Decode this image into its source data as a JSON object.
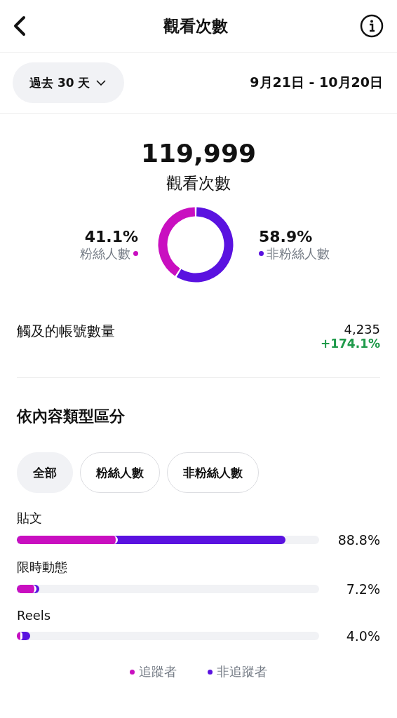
{
  "header": {
    "title": "觀看次數"
  },
  "filter": {
    "period": "過去 30 天",
    "date_range": "9月21日 - 10月20日"
  },
  "summary": {
    "total": "119,999",
    "label": "觀看次數",
    "stats": [
      {
        "value": "41.1%",
        "color": "#c90fc0"
      },
      {
        "value": "58.9%",
        "color": "#5a12e0"
      }
    ],
    "chart_data": {
      "type": "donut",
      "categories": [
        "粉絲人數",
        "非粉絲人數"
      ],
      "values": [
        41.1,
        58.9
      ]
    }
  },
  "reach": {
    "label": "觸及的帳號數量",
    "value": "4,235",
    "change": "+174.1%"
  },
  "breakdown": {
    "title": "依內容類型區分",
    "chips": [
      {
        "label": "全部",
        "selected": true
      },
      {
        "label": "粉絲人數",
        "selected": false
      },
      {
        "label": "非粉絲人數",
        "selected": false
      }
    ],
    "rows": [
      {
        "label": "貼文",
        "percent": "88.8%",
        "level": 0.888,
        "followers": {
          "level": 0.335
        }
      },
      {
        "label": "限時動態",
        "percent": "7.2%",
        "level": 0.075,
        "followers": {
          "level": 0.065
        }
      },
      {
        "label": "Reels",
        "percent": "4.0%",
        "level": 0.043,
        "followers": {
          "level": 0.018
        }
      }
    ],
    "legend": [
      {
        "label": "追蹤者",
        "color": "#c90fc0"
      },
      {
        "label": "非追蹤者",
        "color": "#5a12e0"
      }
    ]
  }
}
